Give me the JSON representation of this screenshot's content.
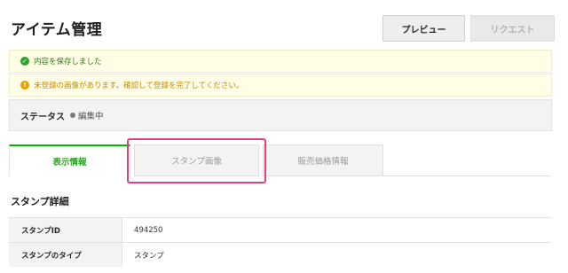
{
  "header": {
    "title": "アイテム管理",
    "preview_label": "プレビュー",
    "request_label": "リクエスト"
  },
  "alerts": {
    "success": {
      "icon": "check-circle-icon",
      "text": "内容を保存しました"
    },
    "warning": {
      "icon": "exclamation-circle-icon",
      "text": "未登録の画像があります。確認して登録を完了してください。"
    }
  },
  "status": {
    "label": "ステータス",
    "value": "編集中"
  },
  "tabs": [
    {
      "label": "表示情報",
      "active": true
    },
    {
      "label": "スタンプ画像",
      "active": false
    },
    {
      "label": "販売価格情報",
      "active": false
    }
  ],
  "section": {
    "title": "スタンプ詳細"
  },
  "details": [
    {
      "label": "スタンプID",
      "value": "494250"
    },
    {
      "label": "スタンプのタイプ",
      "value": "スタンプ"
    }
  ],
  "colors": {
    "accent_green": "#00b900",
    "highlight_pink": "#e5407e",
    "warning_amber": "#c88a00"
  }
}
